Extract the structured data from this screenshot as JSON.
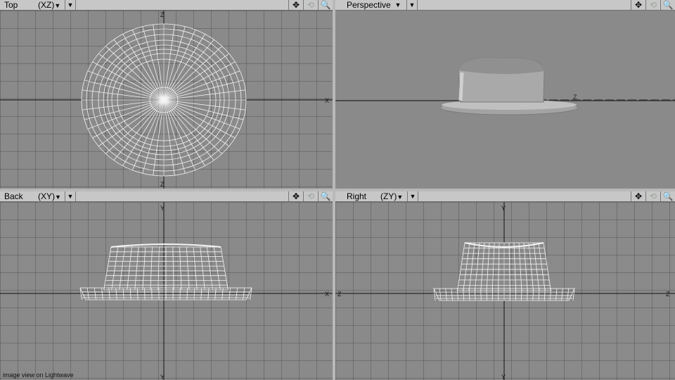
{
  "viewports": {
    "top": {
      "label": "Top",
      "projection": "(XZ)",
      "arrow": "▼",
      "menu_arrow": "▼",
      "axes": {
        "up": "Z",
        "down": "Z",
        "right": "X"
      }
    },
    "persp": {
      "label": "Perspective",
      "projection": "",
      "arrow": "▼",
      "menu_arrow": "▼",
      "axes": {
        "floor": "Z"
      }
    },
    "back": {
      "label": "Back",
      "projection": "(XY)",
      "arrow": "▼",
      "menu_arrow": "▼",
      "axes": {
        "up": "Y",
        "down": "Y",
        "right": "X"
      }
    },
    "right": {
      "label": "Right",
      "projection": "(ZY)",
      "arrow": "▼",
      "menu_arrow": "▼",
      "axes": {
        "up": "Y",
        "down": "Y",
        "left": "Z",
        "right": "Z"
      }
    }
  },
  "tools": {
    "move": "✥",
    "rotate": "⟲",
    "zoom": "🔍"
  },
  "caption": "image view on Lightwave",
  "colors": {
    "viewport_bg": "#8a8a8a",
    "wire": "#f4f4f4",
    "frame": "#b9b9b9"
  }
}
